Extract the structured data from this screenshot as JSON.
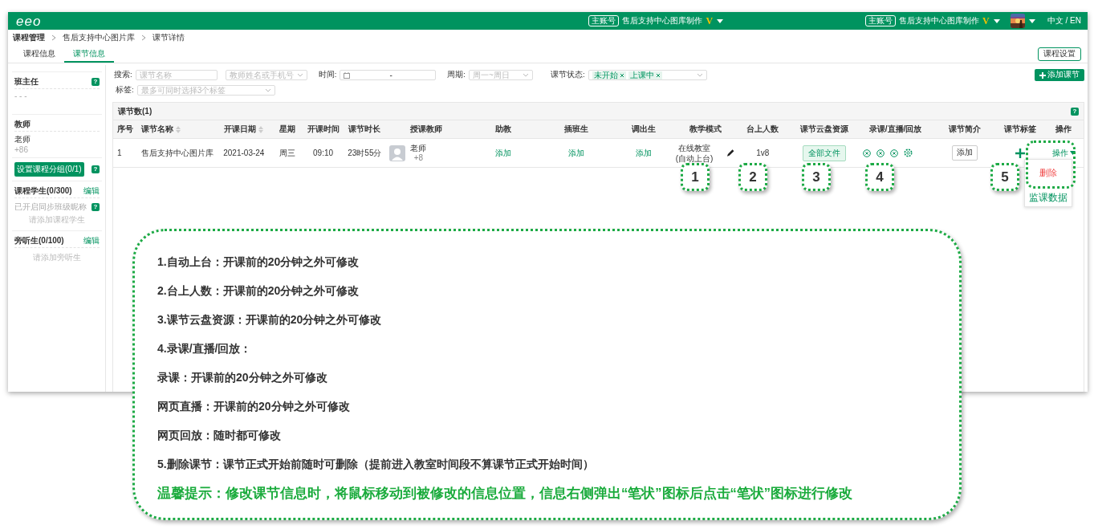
{
  "header": {
    "logo": "eeo",
    "accounts": [
      {
        "badge": "主账号",
        "name": "售后支持中心图库制作",
        "vip": "V"
      },
      {
        "badge": "主账号",
        "name": "售后支持中心图库制作",
        "vip": "V"
      }
    ],
    "language": "中文 / EN"
  },
  "breadcrumb": [
    "课程管理",
    "售后支持中心图片库",
    "课节详情"
  ],
  "tabs": [
    {
      "label": "课程信息",
      "selected": false
    },
    {
      "label": "课节信息",
      "selected": true
    }
  ],
  "course_settings_button": "课程设置",
  "sidebar": {
    "head_teacher": {
      "title": "班主任",
      "help": "?",
      "value": "- - -"
    },
    "teacher": {
      "title": "教师",
      "name": "老师",
      "phone": "+86"
    },
    "group_button": {
      "label": "设置课程分组(0/1)",
      "help": "?"
    },
    "students": {
      "title": "课程学生(0/300)",
      "edit": "编辑",
      "sync_note": "已开启同步班级昵称",
      "help": "?",
      "empty": "请添加课程学生"
    },
    "auditors": {
      "title": "旁听生(0/100)",
      "edit": "编辑",
      "empty": "请添加旁听生"
    }
  },
  "filters": {
    "search_label": "搜索:",
    "name_placeholder": "课节名称",
    "teacher_placeholder": "教师姓名或手机号",
    "time_label": "时间:",
    "time_separator": "-",
    "period_label": "周期:",
    "period_placeholder": "周一~周日",
    "status_label": "课节状态:",
    "status_tags": [
      "未开始",
      "上课中"
    ],
    "add_button": "添加课节",
    "tag_label": "标签:",
    "tag_placeholder": "最多可同时选择3个标签"
  },
  "table": {
    "title": "课节数(1)",
    "help": "?",
    "columns": [
      {
        "label": "序号",
        "sortable": false
      },
      {
        "label": "课节名称",
        "sortable": true
      },
      {
        "label": "开课日期",
        "sortable": true
      },
      {
        "label": "星期",
        "sortable": false
      },
      {
        "label": "开课时间",
        "sortable": false
      },
      {
        "label": "课节时长",
        "sortable": false
      },
      {
        "label": "授课教师",
        "sortable": false
      },
      {
        "label": "助教",
        "sortable": false
      },
      {
        "label": "插班生",
        "sortable": false
      },
      {
        "label": "调出生",
        "sortable": false
      },
      {
        "label": "教学模式",
        "sortable": false
      },
      {
        "label": "台上人数",
        "sortable": false
      },
      {
        "label": "课节云盘资源",
        "sortable": false
      },
      {
        "label": "录课/直播/回放",
        "sortable": false
      },
      {
        "label": "课节简介",
        "sortable": false
      },
      {
        "label": "课节标签",
        "sortable": false
      },
      {
        "label": "操作",
        "sortable": false
      }
    ],
    "rows": [
      {
        "index": "1",
        "name": "售后支持中心图片库",
        "date": "2021-03-24",
        "weekday": "周三",
        "start_time": "09:10",
        "duration": "23时55分",
        "teacher": {
          "name": "老师",
          "phone": "+8"
        },
        "assistant": "添加",
        "transfer_in": "添加",
        "transfer_out": "添加",
        "mode": "在线教室",
        "mode_note": "(自动上台)",
        "seats": "1v8",
        "cloud_button": "全部文件",
        "intro_button": "添加",
        "action": "操作"
      }
    ]
  },
  "dropdown_menu": [
    {
      "label": "删除",
      "kind": "danger"
    },
    {
      "label": "监课数据",
      "kind": "link"
    }
  ],
  "callouts": [
    "1",
    "2",
    "3",
    "4",
    "5"
  ],
  "notes": [
    {
      "text": "1.自动上台：开课前的20分钟之外可修改",
      "kind": "note"
    },
    {
      "text": "2.台上人数：开课前的20分钟之外可修改",
      "kind": "note"
    },
    {
      "text": "3.课节云盘资源：开课前的20分钟之外可修改",
      "kind": "note"
    },
    {
      "text": "4.录课/直播/回放：",
      "kind": "note"
    },
    {
      "text": "录课：开课前的20分钟之外可修改",
      "kind": "note"
    },
    {
      "text": "网页直播：开课前的20分钟之外可修改",
      "kind": "note"
    },
    {
      "text": "网页回放：随时都可修改",
      "kind": "note"
    },
    {
      "text": "5.删除课节：课节正式开始前随时可删除（提前进入教室时间段不算课节正式开始时间）",
      "kind": "note"
    },
    {
      "text": "温馨提示：修改课节信息时，将鼠标移动到被修改的信息位置，信息右侧弹出“笔状”图标后点击“笔状”图标进行修改",
      "kind": "tip"
    }
  ]
}
